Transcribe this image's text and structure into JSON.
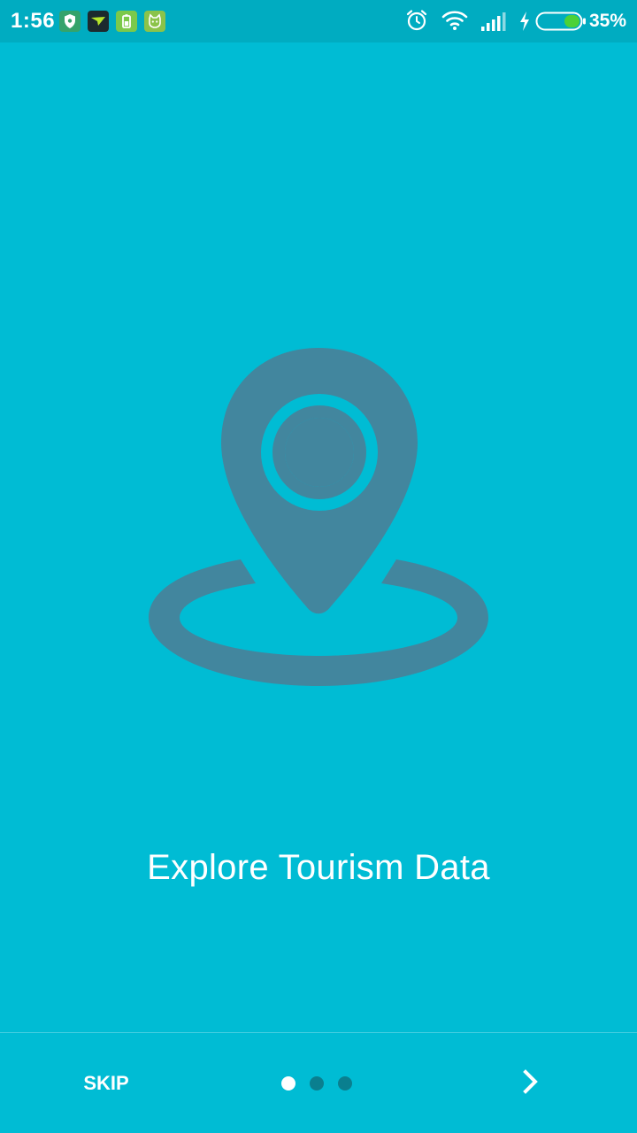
{
  "status_bar": {
    "time": "1:56",
    "battery_percent": "35%",
    "notification_icons": [
      "shield-icon",
      "paper-plane-icon",
      "battery-app-icon",
      "cat-face-icon"
    ],
    "system_icons": [
      "alarm-icon",
      "wifi-icon",
      "signal-icon",
      "charging-icon",
      "battery-icon"
    ]
  },
  "onboarding": {
    "illustration": "location-pin-icon",
    "title": "Explore Tourism Data",
    "current_page": 1,
    "total_pages": 3
  },
  "footer": {
    "skip_label": "SKIP",
    "next_icon": "chevron-right-icon"
  },
  "colors": {
    "background": "#00BCD4",
    "status_bar": "#00ACC1",
    "illustration": "#42869E",
    "dot_inactive": "#0A7F8F",
    "dot_active": "#FFFFFF",
    "battery_fill": "#4CD137"
  }
}
